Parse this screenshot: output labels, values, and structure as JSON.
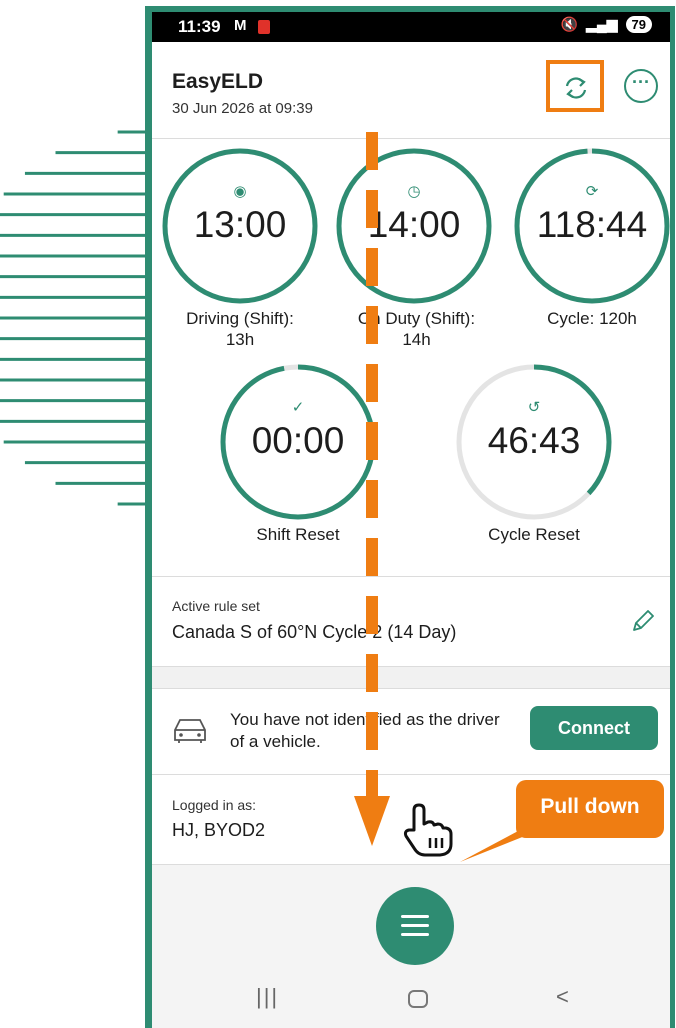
{
  "status_bar": {
    "time": "11:39",
    "gmail": "M",
    "battery": "79"
  },
  "header": {
    "title": "EasyELD",
    "date": "30 Jun 2026 at 09:39"
  },
  "icons": {
    "refresh": "refresh-icon",
    "more": "more-icon",
    "steering": "steering-wheel-icon",
    "clock": "clock-icon",
    "cycle": "cycle-icon",
    "check": "check-icon",
    "reset": "reset-icon",
    "edit": "pencil-icon",
    "vehicle": "car-icon",
    "menu": "menu-icon",
    "hand": "hand-pointer-icon"
  },
  "gauges": [
    {
      "value": "13:00",
      "label_line1": "Driving (Shift):",
      "label_line2": "13h",
      "progress": 1.0
    },
    {
      "value": "14:00",
      "label_line1": "On Duty (Shift):",
      "label_line2": "14h",
      "progress": 1.0
    },
    {
      "value": "118:44",
      "label_line1": "Cycle: 120h",
      "label_line2": "",
      "progress": 0.99
    },
    {
      "value": "00:00",
      "label_line1": "Shift Reset",
      "label_line2": "",
      "progress": 0.97
    },
    {
      "value": "46:43",
      "label_line1": "Cycle Reset",
      "label_line2": "",
      "progress": 0.37
    }
  ],
  "rule_set": {
    "caption": "Active rule set",
    "value": "Canada S of 60°N Cycle 2 (14 Day)"
  },
  "vehicle": {
    "message": "You have not identified as the driver of a vehicle.",
    "connect_label": "Connect"
  },
  "login": {
    "caption": "Logged in as:",
    "value": "HJ, BYOD2"
  },
  "overlay": {
    "callout": "Pull down"
  },
  "colors": {
    "accent": "#2e8c72",
    "highlight": "#ef7d12"
  }
}
